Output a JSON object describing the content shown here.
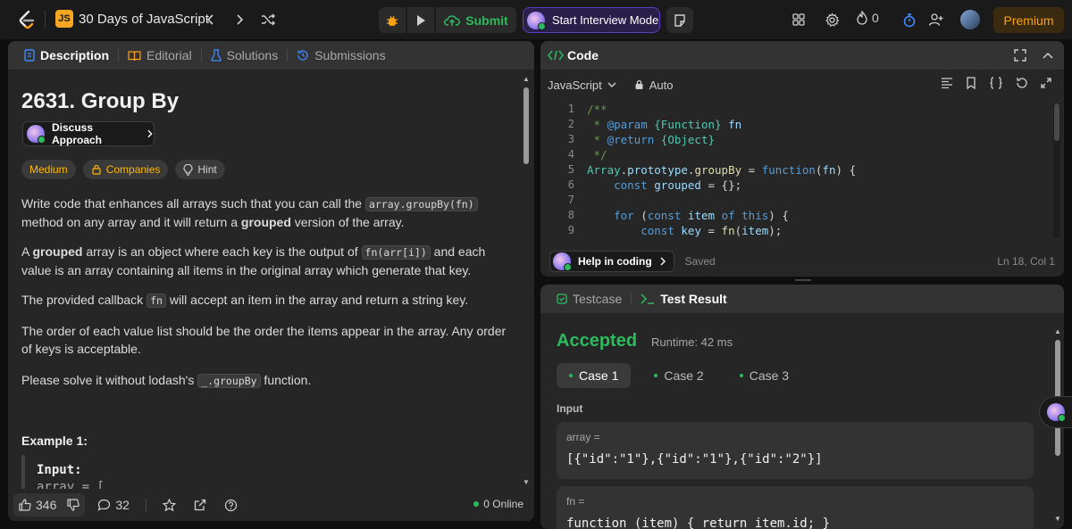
{
  "topbar": {
    "badge": "JS",
    "list_title": "30 Days of JavaScript",
    "submit_label": "Submit",
    "interview_label": "Start Interview Mode",
    "streak_count": "0",
    "premium_label": "Premium"
  },
  "left_tabs": [
    {
      "label": "Description"
    },
    {
      "label": "Editorial"
    },
    {
      "label": "Solutions"
    },
    {
      "label": "Submissions"
    }
  ],
  "problem": {
    "title": "2631. Group By",
    "discuss_label": "Discuss Approach",
    "difficulty": "Medium",
    "companies_label": "Companies",
    "hint_label": "Hint",
    "p1_a": "Write code that enhances all arrays such that you can call the ",
    "p1_code": "array.groupBy(fn)",
    "p1_b": " method on any array and it will return a ",
    "p1_bold": "grouped",
    "p1_c": " version of the array.",
    "p2_a": "A ",
    "p2_bold": "grouped",
    "p2_b": " array is an object where each key is the output of ",
    "p2_code": "fn(arr[i])",
    "p2_c": " and each value is an array containing all items in the original array which generate that key.",
    "p3_a": "The provided callback ",
    "p3_code": "fn",
    "p3_b": " will accept an item in the array and return a string key.",
    "p4": "The order of each value list should be the order the items appear in the array. Any order of keys is acceptable.",
    "p5_a": "Please solve it without lodash's ",
    "p5_code": "_.groupBy",
    "p5_b": " function.",
    "example_title": "Example 1:",
    "example_input_label": "Input:",
    "example_input_line": "array = ["
  },
  "bottombar": {
    "likes": "346",
    "comments": "32",
    "online": "0 Online"
  },
  "code_panel": {
    "title": "Code",
    "language": "JavaScript",
    "mode": "Auto",
    "help_label": "Help in coding",
    "saved_label": "Saved",
    "cursor": "Ln 18, Col 1",
    "line_numbers": [
      "1",
      "2",
      "3",
      "4",
      "5",
      "6",
      "7",
      "8",
      "9"
    ]
  },
  "test_panel": {
    "tab_testcase": "Testcase",
    "tab_result": "Test Result",
    "status": "Accepted",
    "runtime": "Runtime: 42 ms",
    "cases": [
      "Case 1",
      "Case 2",
      "Case 3"
    ],
    "input_label": "Input",
    "field1_name": "array =",
    "field1_value": "[{\"id\":\"1\"},{\"id\":\"1\"},{\"id\":\"2\"}]",
    "field2_name": "fn =",
    "field2_value": "function (item) { return item.id; }"
  }
}
